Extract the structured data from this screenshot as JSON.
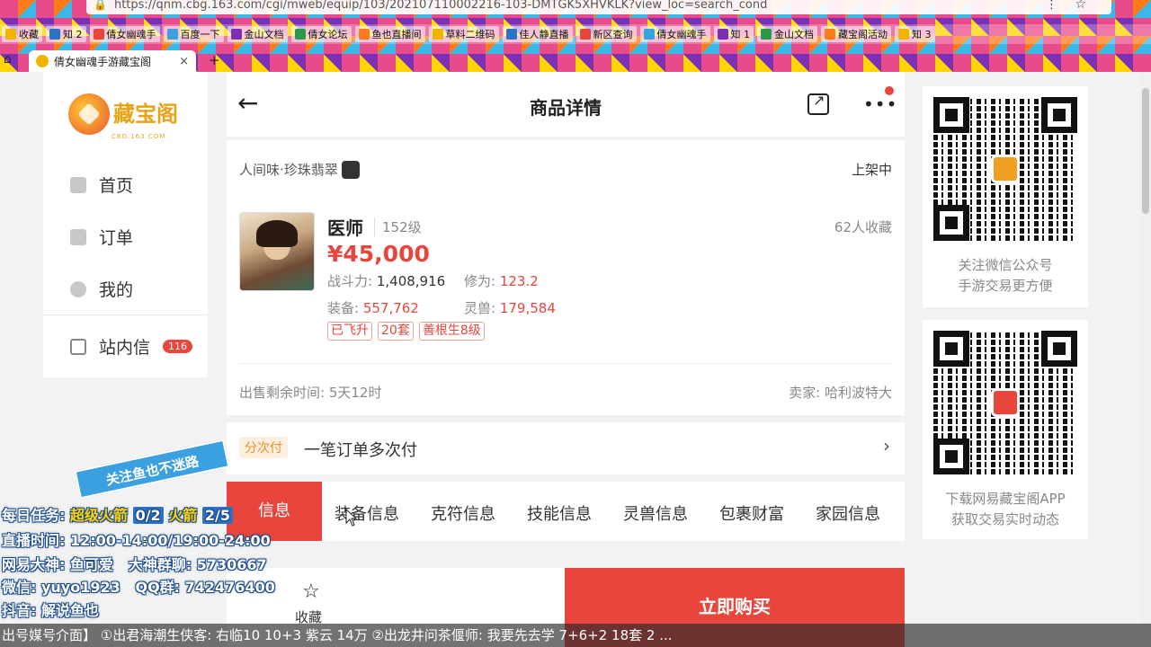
{
  "browser": {
    "url": "https://qnm.cbg.163.com/cgi/mweb/equip/103/202107110002216-103-DMTGK5XHVKLK?view_loc=search_cond",
    "bookmarks": [
      "收藏",
      "知 2",
      "倩女幽魂手",
      "百度一下",
      "金山文档",
      "倩女论坛",
      "鱼也直播间",
      "草料二维码",
      "佳人静直播",
      "新区查询",
      "倩女幽魂手",
      "知 1",
      "金山文档",
      "藏宝阁活动",
      "知 3"
    ],
    "tab_title": "倩女幽魂手游藏宝阁",
    "tab_close": "×",
    "new_tab": "+"
  },
  "nav": {
    "logo_text": "藏宝阁",
    "logo_sub": "CBG.163.COM",
    "items": [
      {
        "label": "首页"
      },
      {
        "label": "订单"
      },
      {
        "label": "我的"
      },
      {
        "label": "站内信",
        "badge": "116"
      }
    ]
  },
  "header": {
    "title": "商品详情",
    "back": "←",
    "more": "•••"
  },
  "item": {
    "server": "人间味·珍珠翡翠",
    "platform_icon": "",
    "status": "上架中",
    "role": "医师",
    "level": "152级",
    "favorites": "62人收藏",
    "price": "¥45,000",
    "power_label": "战斗力:",
    "power_value": "1,408,916",
    "cultivation_label": "修为:",
    "cultivation_value": "123.2",
    "equip_label": "装备:",
    "equip_value": "557,762",
    "pet_label": "灵兽:",
    "pet_value": "179,584",
    "tags": [
      "已飞升",
      "20套",
      "善根生8级"
    ],
    "remaining": "出售剩余时间: 5天12时",
    "seller": "卖家: 哈利波特大"
  },
  "installment": {
    "tag": "分次付",
    "text": "一笔订单多次付",
    "arrow": "›"
  },
  "detail_tabs": [
    "信息",
    "装备信息",
    "克符信息",
    "技能信息",
    "灵兽信息",
    "包裹财富",
    "家园信息"
  ],
  "bottom": {
    "fav_icon": "☆",
    "fav_label": "收藏",
    "buy_label": "立即购买"
  },
  "qr": {
    "card1_lines": [
      "关注微信公众号",
      "手游交易更方便"
    ],
    "card2_lines": [
      "下载网易藏宝阁APP",
      "获取交易实时动态"
    ]
  },
  "overlay": {
    "banner": "关注鱼也不迷路",
    "task_label": "每日任务:",
    "task_item1": "超级火箭",
    "task_val1": "0/2",
    "task_item2": "火箭",
    "task_val2": "2/5",
    "live_time": "直播时间: 12:00-14:00/19:00-24:00",
    "netease": "网易大神: 鱼可爱",
    "group": "大神群聊: 5730667",
    "wechat": "微信: yuyo1923",
    "qq": "QQ群: 742476400",
    "douyin": "抖音: 解说鱼也",
    "ticker": "出号媒号介面】 ①出君海潮生侠客: 右临10 10+3 紫云 14万 ②出龙井问茶偃师: 我要先去学 7+6+2 18套 2 ..."
  }
}
